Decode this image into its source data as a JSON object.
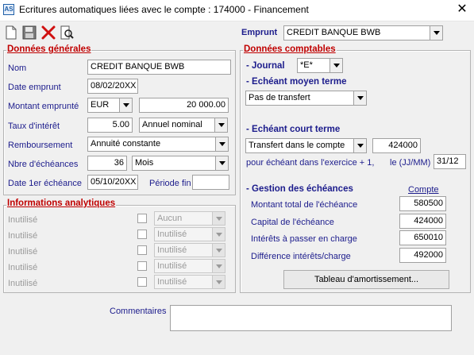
{
  "window": {
    "title": "Ecritures automatiques liées avec le compte : 174000 - Financement",
    "app_icon_text": "AS"
  },
  "toolbar": {
    "emprunt_label": "Emprunt",
    "emprunt_value": "CREDIT BANQUE BWB"
  },
  "general": {
    "title": "Données générales",
    "nom_label": "Nom",
    "nom_value": "CREDIT BANQUE BWB",
    "date_emprunt_label": "Date emprunt",
    "date_emprunt_value": "08/02/20XX",
    "montant_label": "Montant emprunté",
    "devise_value": "EUR",
    "montant_value": "20 000.00",
    "taux_label": "Taux d'intérêt",
    "taux_value": "5.00",
    "taux_type_value": "Annuel nominal",
    "remboursement_label": "Remboursement",
    "remboursement_value": "Annuité constante",
    "nbre_label": "Nbre d'échéances",
    "nbre_value": "36",
    "periodicite_value": "Mois",
    "date_1er_label": "Date 1er échéance",
    "date_1er_value": "05/10/20XX",
    "periode_fin_label": "Période fin",
    "periode_fin_value": ""
  },
  "analytics": {
    "title": "Informations analytiques",
    "rows": [
      {
        "label": "Inutilisé",
        "value": "Aucun"
      },
      {
        "label": "Inutilisé",
        "value": "Inutilisé"
      },
      {
        "label": "Inutilisé",
        "value": "Inutilisé"
      },
      {
        "label": "Inutilisé",
        "value": "Inutilisé"
      },
      {
        "label": "Inutilisé",
        "value": "Inutilisé"
      }
    ]
  },
  "comptables": {
    "title": "Données comptables",
    "journal_label": "- Journal",
    "journal_value": "*E*",
    "moyen_terme_label": "- Echéant moyen terme",
    "moyen_terme_value": "Pas de transfert",
    "court_terme_label": "- Echéant court terme",
    "court_terme_value": "Transfert dans le compte",
    "court_terme_compte": "424000",
    "exercice_text": "pour échéant dans l'exercice + 1,",
    "le_label": "le (JJ/MM)",
    "le_value": "31/12",
    "gestion_label": "- Gestion des échéances",
    "compte_header": "Compte",
    "rows": [
      {
        "label": "Montant total de l'échéance",
        "value": "580500"
      },
      {
        "label": "Capital de l'échéance",
        "value": "424000"
      },
      {
        "label": "Intérêts à passer en charge",
        "value": "650010"
      },
      {
        "label": "Différence intérêts/charge",
        "value": "492000"
      }
    ],
    "tableau_button": "Tableau d'amortissement..."
  },
  "commentaires": {
    "label": "Commentaires",
    "value": ""
  },
  "colors": {
    "group_title": "#c00000",
    "section_title": "#1c1c8c",
    "background": "#f0f0f0"
  }
}
